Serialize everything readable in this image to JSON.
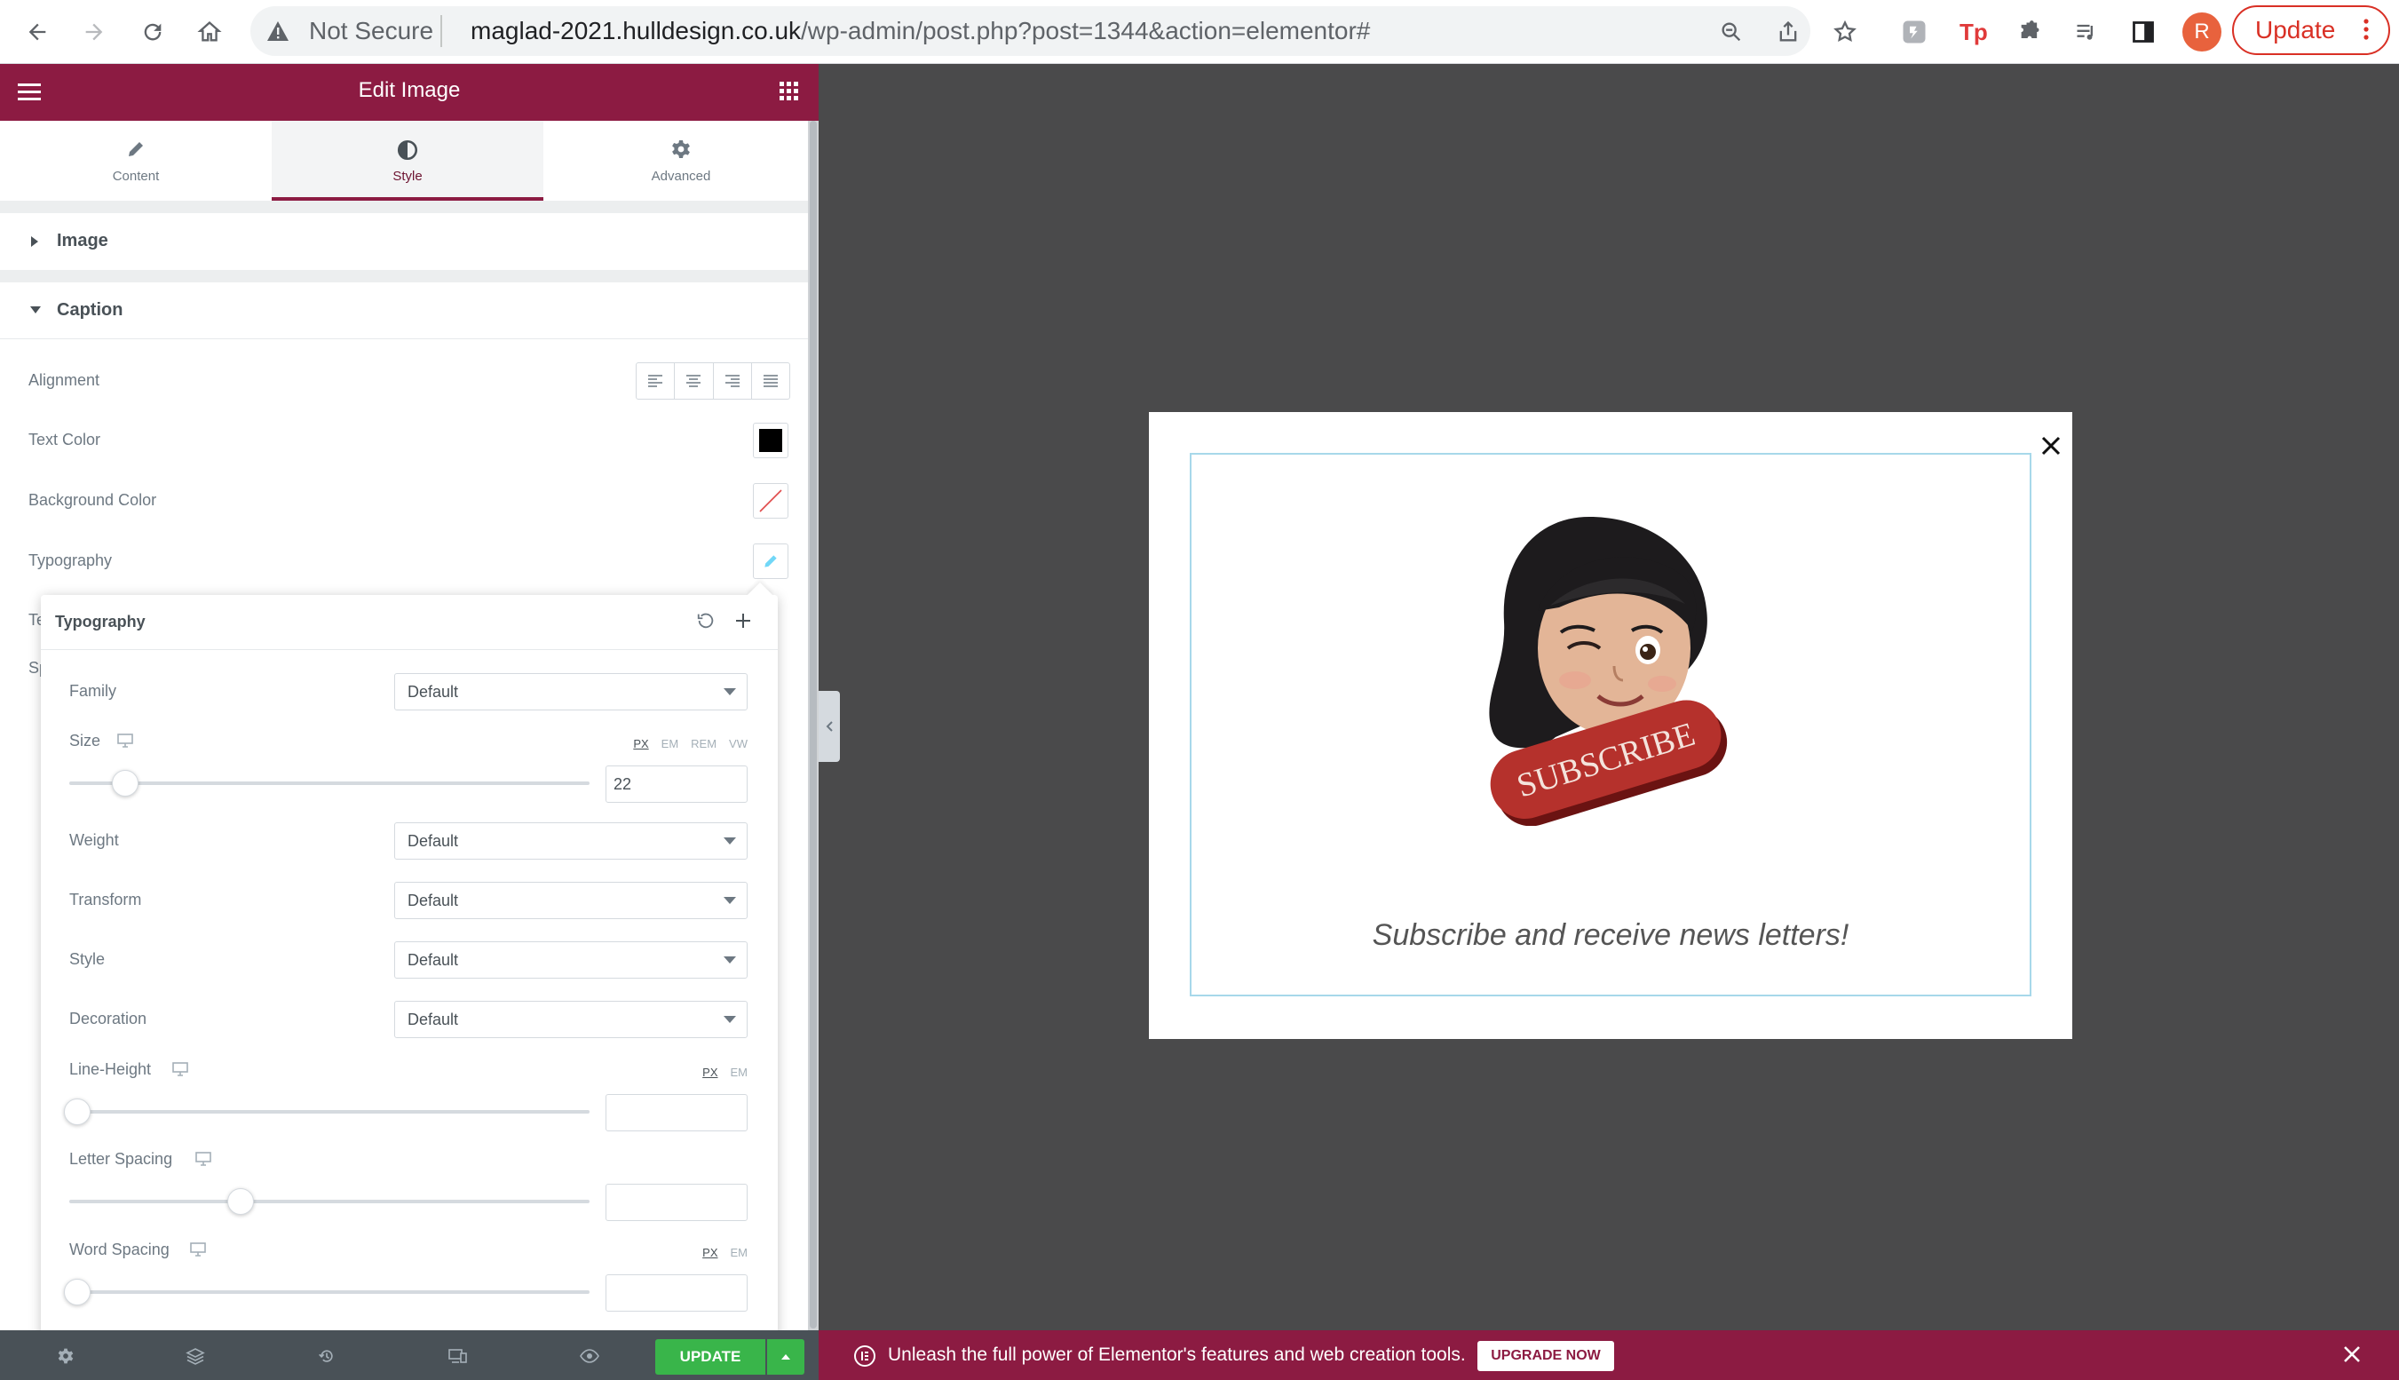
{
  "browser": {
    "security_label": "Not Secure",
    "url_host": "maglad-2021.hulldesign.co.uk",
    "url_path": "/wp-admin/post.php?post=1344&action=elementor#",
    "profile_initial": "R",
    "update_label": "Update"
  },
  "panel": {
    "header_title": "Edit Image",
    "tabs": [
      {
        "label": "Content"
      },
      {
        "label": "Style"
      },
      {
        "label": "Advanced"
      }
    ],
    "active_tab": "Style",
    "sections": {
      "image_label": "Image",
      "caption_label": "Caption"
    },
    "caption_controls": {
      "alignment_label": "Alignment",
      "text_color_label": "Text Color",
      "text_color_value": "#000000",
      "background_color_label": "Background Color",
      "typography_label": "Typography",
      "peek_t": "Te",
      "peek_s": "Sp"
    }
  },
  "typography_popover": {
    "title": "Typography",
    "family": {
      "label": "Family",
      "value": "Default"
    },
    "size": {
      "label": "Size",
      "units": [
        "PX",
        "EM",
        "REM",
        "VW"
      ],
      "active_unit": "PX",
      "value": "22"
    },
    "weight": {
      "label": "Weight",
      "value": "Default"
    },
    "transform": {
      "label": "Transform",
      "value": "Default"
    },
    "style": {
      "label": "Style",
      "value": "Default"
    },
    "decoration": {
      "label": "Decoration",
      "value": "Default"
    },
    "line_height": {
      "label": "Line-Height",
      "units": [
        "PX",
        "EM"
      ],
      "active_unit": "PX",
      "value": ""
    },
    "letter_spacing": {
      "label": "Letter Spacing",
      "value": ""
    },
    "word_spacing": {
      "label": "Word Spacing",
      "units": [
        "PX",
        "EM"
      ],
      "active_unit": "PX",
      "value": ""
    }
  },
  "footer": {
    "update_label": "UPDATE"
  },
  "canvas": {
    "popup_badge_text": "SUBSCRIBE",
    "caption_text": "Subscribe and receive news letters!"
  },
  "promo": {
    "message": "Unleash the full power of Elementor's features and web creation tools.",
    "button_label": "UPGRADE NOW"
  },
  "colors": {
    "brand": "#8c1b42",
    "update_green": "#39b54a",
    "canvas_bg": "#4a4a4b"
  }
}
